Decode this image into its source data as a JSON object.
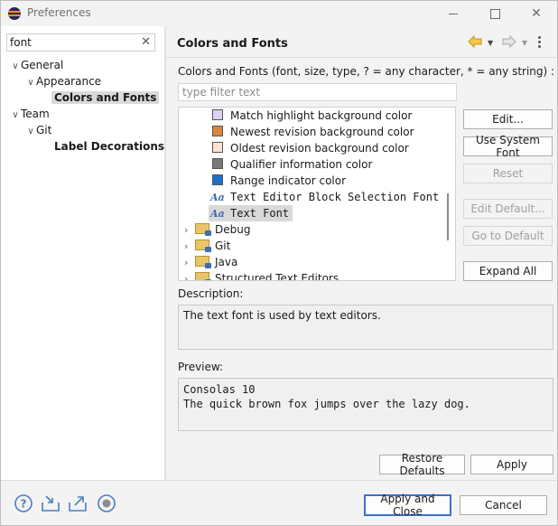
{
  "window": {
    "title": "Preferences"
  },
  "sidebar": {
    "filter_value": "font",
    "tree": [
      {
        "label": "General",
        "expanded": true,
        "children": [
          {
            "label": "Appearance",
            "expanded": true,
            "children": [
              {
                "label": "Colors and Fonts",
                "selected": true
              }
            ]
          }
        ]
      },
      {
        "label": "Team",
        "expanded": true,
        "children": [
          {
            "label": "Git",
            "expanded": true,
            "children": [
              {
                "label": "Label Decorations"
              }
            ]
          }
        ]
      }
    ]
  },
  "page": {
    "title": "Colors and Fonts",
    "section_label": "Colors and Fonts (font, size, type, ? = any character, * = any string) :",
    "filter_placeholder": "type filter text",
    "items": [
      {
        "kind": "color",
        "label": "Match highlight background color",
        "swatch": "#dcd2f5"
      },
      {
        "kind": "color",
        "label": "Newest revision background color",
        "swatch": "#d9883a"
      },
      {
        "kind": "color",
        "label": "Oldest revision background color",
        "swatch": "#fde3cc"
      },
      {
        "kind": "color",
        "label": "Qualifier information color",
        "swatch": "#7a7a7a"
      },
      {
        "kind": "color",
        "label": "Range indicator color",
        "swatch": "#1e6fcc"
      },
      {
        "kind": "font",
        "label": "Text Editor Block Selection Font"
      },
      {
        "kind": "font",
        "label": "Text Font",
        "selected": true
      },
      {
        "kind": "category",
        "label": "Debug"
      },
      {
        "kind": "category",
        "label": "Git"
      },
      {
        "kind": "category",
        "label": "Java"
      },
      {
        "kind": "category",
        "label": "Structured Text Editors"
      }
    ],
    "font_icon_glyph": "Aa",
    "buttons": {
      "edit": "Edit...",
      "use_system_font": "Use System Font",
      "reset": "Reset",
      "edit_default": "Edit Default...",
      "go_to_default": "Go to Default",
      "expand_all": "Expand All"
    },
    "description_label": "Description:",
    "description_text": "The text font is used by text editors.",
    "preview_label": "Preview:",
    "preview_lines": [
      "Consolas 10",
      "The quick brown fox jumps over the lazy dog."
    ],
    "restore_defaults": "Restore Defaults",
    "apply": "Apply"
  },
  "footer": {
    "apply_and_close": "Apply and Close",
    "cancel": "Cancel"
  },
  "icons": {
    "help": "help-icon",
    "import": "import-icon",
    "export": "export-icon",
    "record": "oomph-record-icon",
    "back": "back-arrow-icon",
    "forward": "forward-arrow-icon",
    "view_menu": "view-menu-icon",
    "clear": "clear-filter-icon"
  },
  "colors": {
    "accent": "#3a72c8",
    "selection": "#d9d9d9",
    "nav_back": "#e8b020"
  }
}
